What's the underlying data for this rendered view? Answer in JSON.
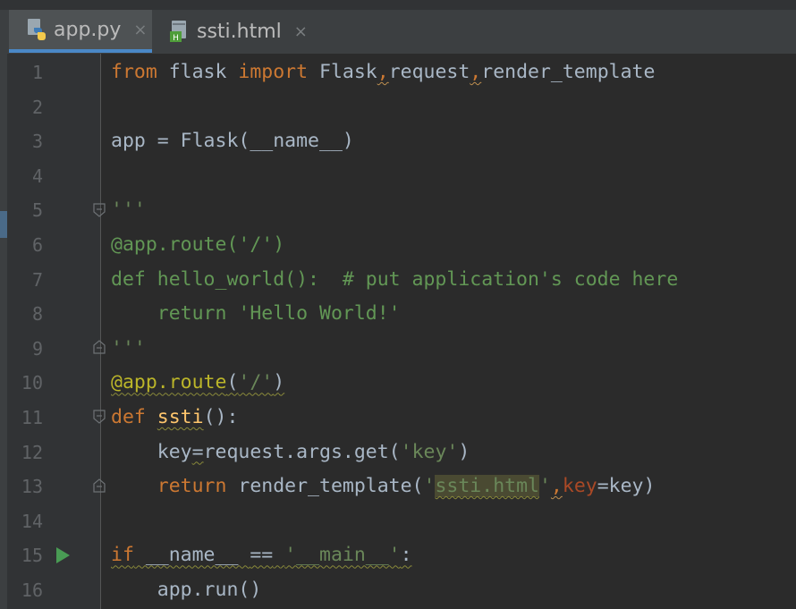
{
  "tabs": [
    {
      "label": "app.py",
      "close": "×",
      "icon": "python-file-icon",
      "active": true
    },
    {
      "label": "ssti.html",
      "close": "×",
      "icon": "html-file-icon",
      "active": false
    }
  ],
  "gutter": {
    "line_numbers": [
      "1",
      "2",
      "3",
      "4",
      "5",
      "6",
      "7",
      "8",
      "9",
      "10",
      "11",
      "12",
      "13",
      "14",
      "15",
      "16"
    ],
    "run_marker_line": "15"
  },
  "code": {
    "l1": {
      "from": "from",
      "flask": " flask ",
      "import": "import",
      "flask_cls": " Flask",
      "comma1": ",",
      "request": "request",
      "comma2": ",",
      "render": "render_template"
    },
    "l3": {
      "text": "app = Flask(__name__)"
    },
    "l5": {
      "text": "'''"
    },
    "l6": {
      "text": "@app.route('/')"
    },
    "l7": {
      "text": "def hello_world():  # put application's code here"
    },
    "l8": {
      "text": "    return 'Hello World!'"
    },
    "l9": {
      "text": "'''"
    },
    "l10": {
      "dec": "@app.route",
      "open": "(",
      "str": "'/'",
      "close": ")"
    },
    "l11": {
      "def": "def",
      "name": "ssti",
      "rest": "():"
    },
    "l12": {
      "indent": "    ",
      "key": "key",
      "eq": "=",
      "rest": "request.args.get(",
      "str": "'key'",
      "close": ")"
    },
    "l13": {
      "indent": "    ",
      "ret": "return",
      "call": " render_template(",
      "q1": "'",
      "file": "ssti.html",
      "q2": "'",
      "comma": ",",
      "param": "key",
      "eq": "=",
      "rest": "key)"
    },
    "l15": {
      "if": "if",
      "name": " __name__ ",
      "op": "==",
      "sp": " ",
      "str": "'__main__'",
      "colon": ":"
    },
    "l16": {
      "text": "    app.run()"
    }
  },
  "colors": {
    "keyword": "#cc7832",
    "string": "#6a8759",
    "decorator": "#bbb529",
    "function": "#ffc66d",
    "parameter": "#aa4926",
    "text": "#a9b7c6",
    "background": "#2b2b2b",
    "run": "#499c54"
  }
}
